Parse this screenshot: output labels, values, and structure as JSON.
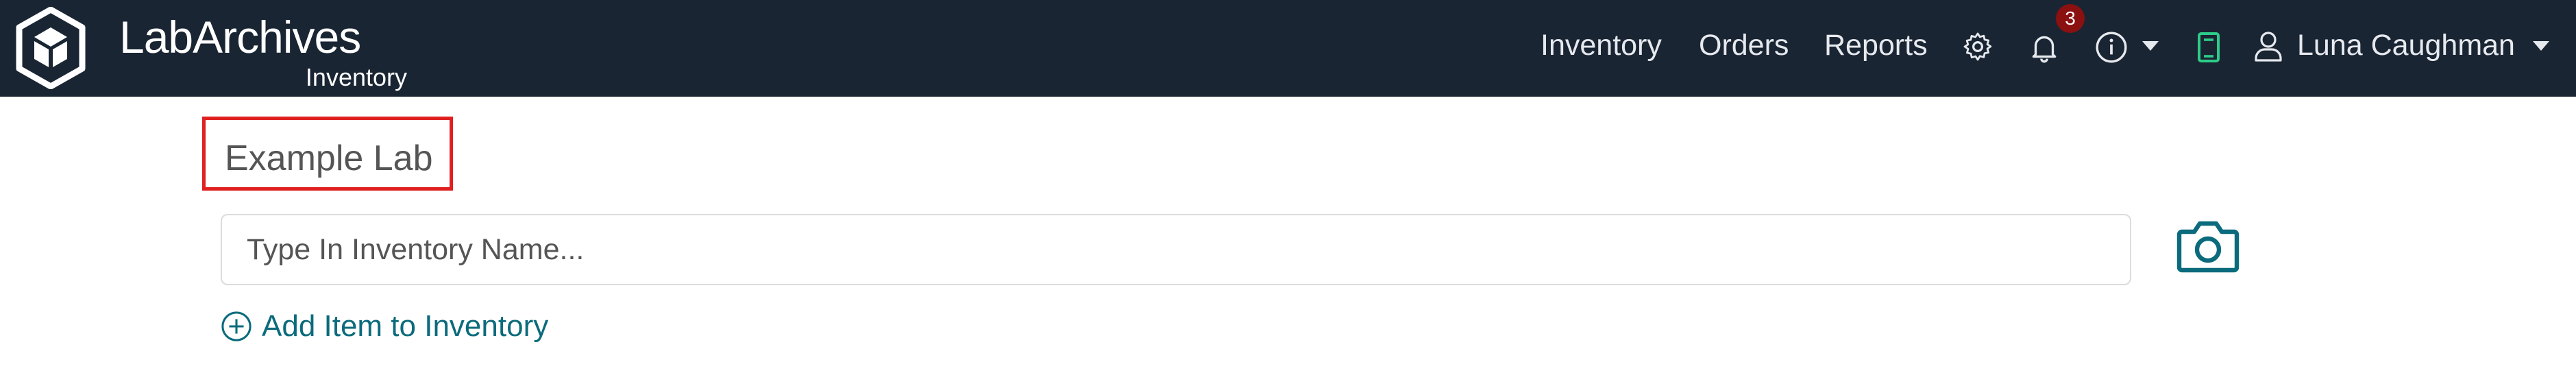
{
  "brand": {
    "name": "LabArchives",
    "product": "Inventory"
  },
  "nav": {
    "links": [
      "Inventory",
      "Orders",
      "Reports"
    ],
    "notification_count": "3",
    "user_name": "Luna Caughman"
  },
  "icons": {
    "logo": "labarchives-cube-logo",
    "settings": "gear-icon",
    "notifications": "bell-icon",
    "info": "info-icon",
    "notebook": "notebook-icon",
    "user": "user-icon",
    "camera": "camera-icon",
    "add": "plus-circle-icon"
  },
  "colors": {
    "navbar": "#1a2533",
    "accent": "#0b6b7c",
    "highlight": "#e02020",
    "notebook": "#2ecc8a",
    "badge": "#8b1010"
  },
  "main": {
    "lab_title": "Example Lab",
    "search_placeholder": "Type In Inventory Name...",
    "search_value": "",
    "add_item_label": "Add Item to Inventory"
  }
}
